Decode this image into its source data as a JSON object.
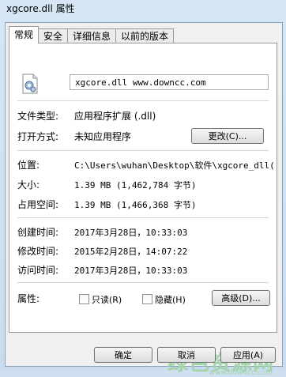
{
  "window": {
    "title": "xgcore.dll 属性"
  },
  "tabs": [
    "常规",
    "安全",
    "详细信息",
    "以前的版本"
  ],
  "general": {
    "filename": "xgcore.dll  www.downcc.com",
    "type_label": "文件类型:",
    "type_value": "应用程序扩展 (.dll)",
    "open_label": "打开方式:",
    "open_value": "未知应用程序",
    "change_button": "更改(C)...",
    "location_label": "位置:",
    "location_value": "C:\\Users\\wuhan\\Desktop\\软件\\xgcore_dll(jb",
    "size_label": "大小:",
    "size_value": "1.39 MB (1,462,784 字节)",
    "disk_label": "占用空间:",
    "disk_value": "1.39 MB (1,466,368 字节)",
    "created_label": "创建时间:",
    "created_value": "2017年3月28日，10:33:03",
    "modified_label": "修改时间:",
    "modified_value": "2015年2月28日，14:07:22",
    "accessed_label": "访问时间:",
    "accessed_value": "2017年3月28日，10:33:03",
    "attr_label": "属性:",
    "readonly_label": "只读(R)",
    "hidden_label": "隐藏(H)",
    "advanced_button": "高级(D)..."
  },
  "footer": {
    "ok": "确定",
    "cancel": "取消",
    "apply": "应用(A)"
  },
  "watermark": {
    "text": "绿色资源网",
    "sub": "www.downcc.com"
  }
}
